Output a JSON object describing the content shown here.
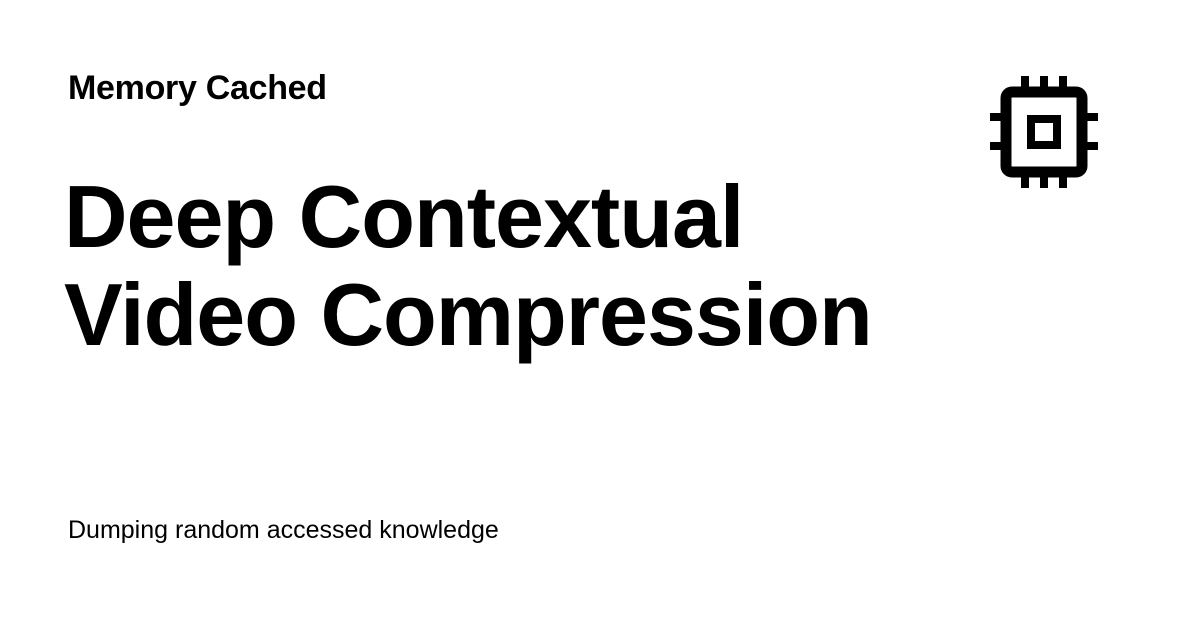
{
  "header": {
    "site_name": "Memory Cached",
    "logo_icon": "cpu-chip-icon"
  },
  "main": {
    "title_lines": [
      "Deep Contextual",
      "Video Compression"
    ]
  },
  "footer": {
    "tagline": "Dumping random accessed knowledge"
  },
  "colors": {
    "background": "#ffffff",
    "text": "#000000"
  }
}
